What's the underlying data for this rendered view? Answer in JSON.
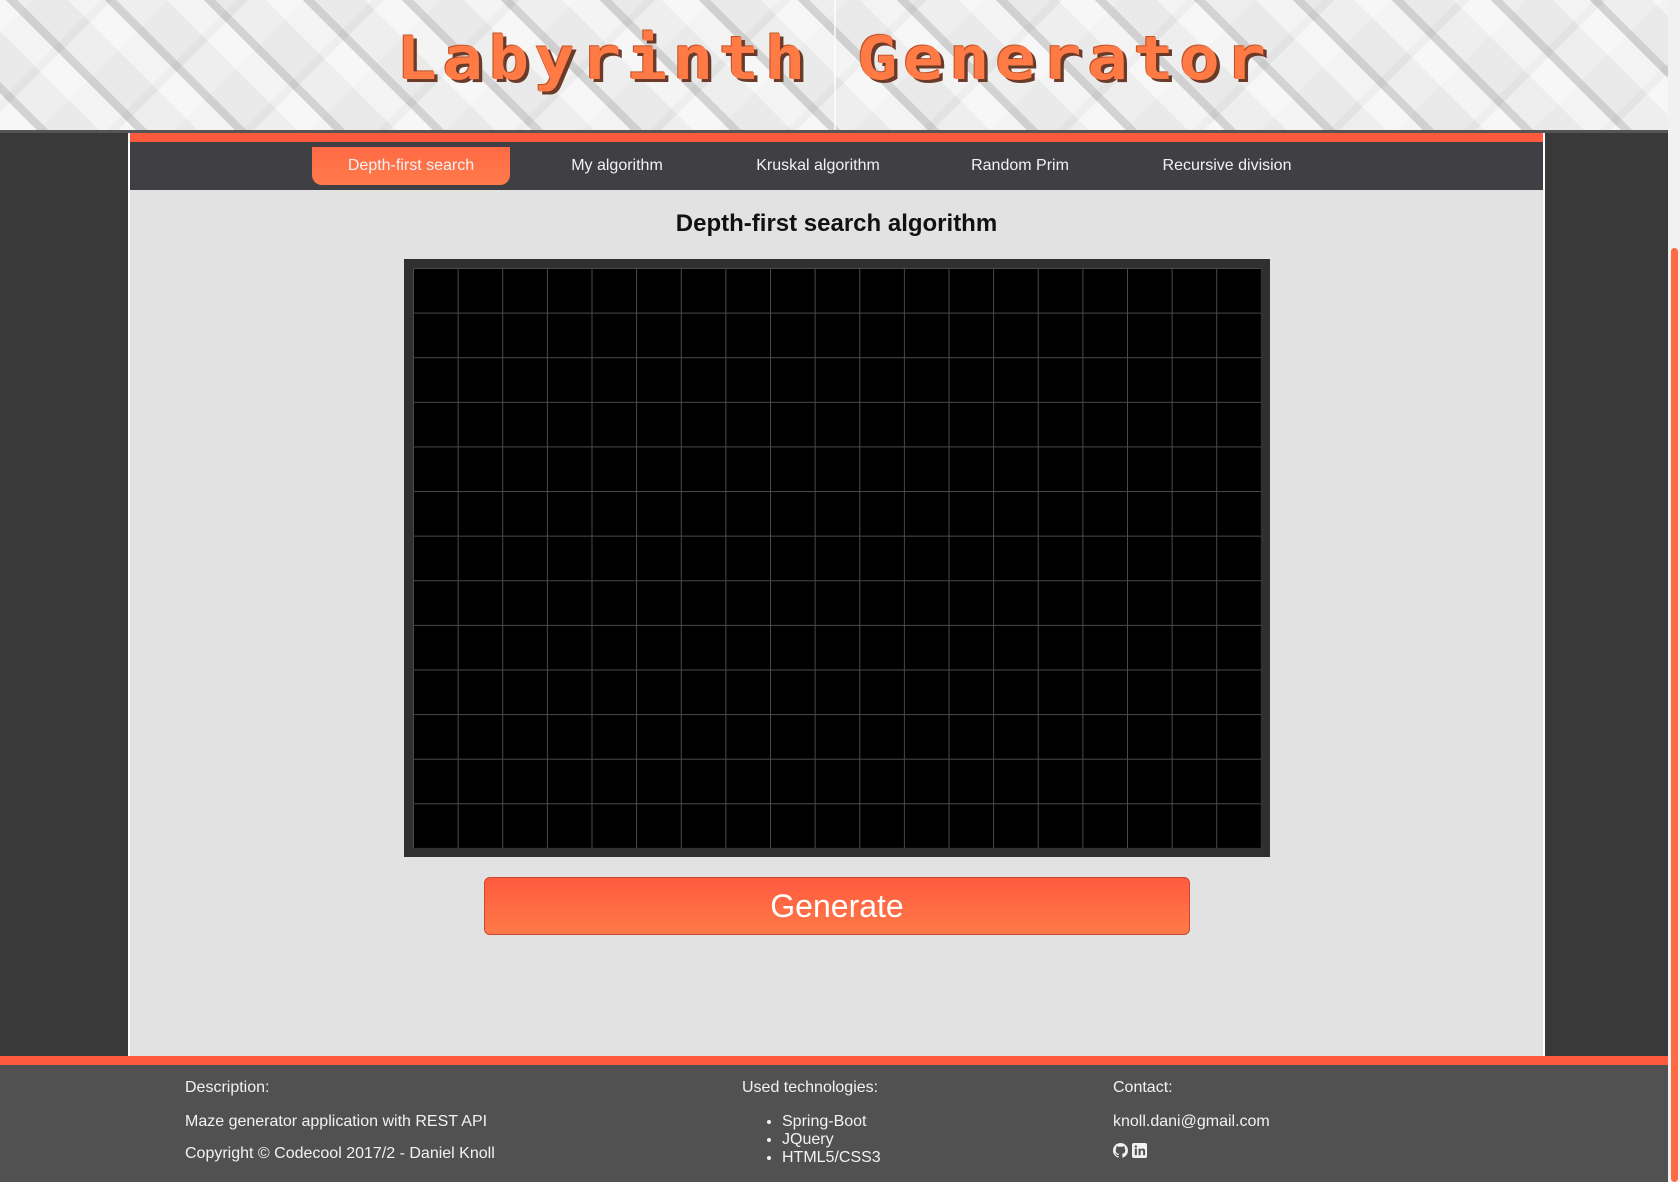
{
  "header": {
    "title": "Labyrinth Generator"
  },
  "nav": {
    "tabs": [
      {
        "label": "Depth-first search",
        "active": true
      },
      {
        "label": "My algorithm",
        "active": false
      },
      {
        "label": "Kruskal algorithm",
        "active": false
      },
      {
        "label": "Random Prim",
        "active": false
      },
      {
        "label": "Recursive division",
        "active": false
      }
    ]
  },
  "main": {
    "algorithm_title": "Depth-first search algorithm",
    "maze": {
      "columns": 19,
      "rows": 13
    },
    "generate_label": "Generate"
  },
  "footer": {
    "description": {
      "heading": "Description:",
      "text": "Maze generator application with REST API",
      "copyright": "Copyright © Codecool 2017/2 - Daniel Knoll"
    },
    "technologies": {
      "heading": "Used technologies:",
      "items": [
        "Spring-Boot",
        "JQuery",
        "HTML5/CSS3"
      ]
    },
    "contact": {
      "heading": "Contact:",
      "email": "knoll.dani@gmail.com",
      "icons": [
        "github-icon",
        "linkedin-icon"
      ]
    }
  },
  "colors": {
    "accent": "#ff5a3e",
    "accent_light": "#ff7a48",
    "nav_bg": "#3f3f44",
    "panel_bg": "#e2e2e2",
    "footer_bg": "#515151",
    "page_bg": "#393939"
  }
}
